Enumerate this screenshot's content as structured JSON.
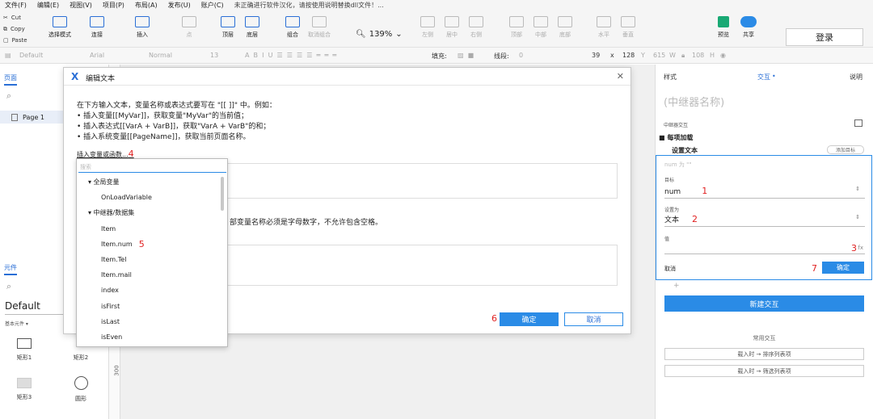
{
  "menubar": {
    "items": [
      "文件(F)",
      "编辑(E)",
      "视图(V)",
      "项目(P)",
      "布局(A)",
      "发布(U)",
      "账户(C)"
    ],
    "notice": "未正确进行软件汉化，请按使用说明替换dll文件！..."
  },
  "toolbar": {
    "clipboard": [
      "Cut",
      "Copy",
      "Paste"
    ],
    "select_mode": "选择模式",
    "connect": "连接",
    "insert": "插入",
    "point": "点",
    "top_layer": "顶层",
    "bottom_layer": "底层",
    "group": "组合",
    "ungroup": "取消组合",
    "zoom": "139%",
    "align_left": "左侧",
    "align_center": "居中",
    "align_right": "右侧",
    "align_top": "顶部",
    "align_middle": "中部",
    "align_bottom": "底部",
    "distribute_h": "水平",
    "distribute_v": "垂直",
    "preview": "预览",
    "share": "共享",
    "login": "登录"
  },
  "formatbar": {
    "style": "Default",
    "font": "Arial",
    "weight": "Normal",
    "size": "13",
    "fill_label": "填充:",
    "line_label": "线段:",
    "line_value": "0",
    "x": "39",
    "x_label": "x",
    "y": "128",
    "y_label": "Y",
    "w": "615",
    "w_label": "W",
    "h": "108",
    "h_label": "H"
  },
  "leftpanel": {
    "pages_tab": "页面",
    "page_name": "Page 1",
    "library_tab": "元件",
    "library_name": "Default",
    "category": "基本元件 ▾",
    "shapes": [
      "矩形1",
      "矩形2",
      "矩形3",
      "圆形"
    ],
    "ruler": "300"
  },
  "dialog": {
    "title": "编辑文本",
    "line1": "在下方输入文本，变量名称或表达式要写在 \"[[ ]]\" 中。例如：",
    "line2": "• 插入变量[[MyVar]]，获取变量\"MyVar\"的当前值；",
    "line3": "• 插入表达式[[VarA + VarB]]，获取\"VarA + VarB\"的和；",
    "line4": "• 插入系统变量[[PageName]]，获取当前页面名称。",
    "insert_link": "插入变量或函数...",
    "marker4": "4",
    "note": "部变量名称必须是字母数字，不允许包含空格。",
    "ok": "确定",
    "cancel": "取消",
    "marker6": "6"
  },
  "dropdown": {
    "search_placeholder": "搜索",
    "items": [
      {
        "label": "▾ 全局变量",
        "level": "group"
      },
      {
        "label": "OnLoadVariable",
        "level": "sub"
      },
      {
        "label": "▾ 中继器/数据集",
        "level": "group"
      },
      {
        "label": "Item",
        "level": "sub"
      },
      {
        "label": "Item.num",
        "level": "sub"
      },
      {
        "label": "Item.Tel",
        "level": "sub"
      },
      {
        "label": "Item.mail",
        "level": "sub"
      },
      {
        "label": "index",
        "level": "sub"
      },
      {
        "label": "isFirst",
        "level": "sub"
      },
      {
        "label": "isLast",
        "level": "sub"
      },
      {
        "label": "isEven",
        "level": "sub"
      }
    ],
    "marker5": "5"
  },
  "rightpanel": {
    "tab_style": "样式",
    "tab_interaction": "交互",
    "tab_notes": "说明",
    "title_placeholder": "(中继器名称)",
    "section": "中继器交互",
    "event": "每项加载",
    "action": "设置文本",
    "add_target": "添加目标",
    "hint": "num 为 \"\"",
    "target_label": "目标",
    "target_value": "num",
    "set_as_label": "设置为",
    "set_as_value": "文本",
    "value_label": "值",
    "marker1": "1",
    "marker2": "2",
    "marker3": "3",
    "marker7": "7",
    "fx": "fx",
    "cancel": "取消",
    "ok": "确定",
    "plus": "+",
    "new_interaction": "新建交互",
    "common_label": "常用交互",
    "common1": "载入时 → 排序列表项",
    "common2": "载入时 → 筛选列表项"
  }
}
